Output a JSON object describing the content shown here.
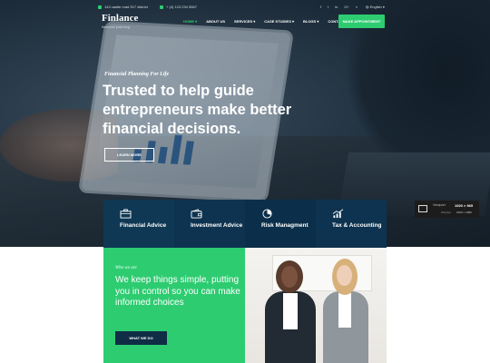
{
  "topbar": {
    "address": "143 castle road 517 district",
    "phone": "+ (4) 123 234 5567",
    "social": [
      "f",
      "t",
      "in",
      "G+",
      "⌕"
    ],
    "language": "English ▾"
  },
  "brand": {
    "name": "Finlance",
    "tagline": "financial planning"
  },
  "nav": {
    "items": [
      {
        "label": "HOME ▾",
        "active": true
      },
      {
        "label": "ABOUT US",
        "active": false
      },
      {
        "label": "SERVICES ▾",
        "active": false
      },
      {
        "label": "CASE STUDIES ▾",
        "active": false
      },
      {
        "label": "BLOGS ▾",
        "active": false
      },
      {
        "label": "CONTACT",
        "active": false
      }
    ],
    "cta": "MAKE APPOINTMENT"
  },
  "hero": {
    "eyebrow": "Financial Planning For Life",
    "headline": "Trusted to help guide entrepreneurs make better financial decisions.",
    "button": "LEARN MORE"
  },
  "viewport_widget": {
    "label": "Viewport:",
    "value": "1920 × 969",
    "sub_label": "Window:",
    "sub_value": "1920 × 1080"
  },
  "services": [
    {
      "label": "Financial Advice",
      "icon": "briefcase-icon"
    },
    {
      "label": "Investment Advice",
      "icon": "wallet-icon"
    },
    {
      "label": "Risk Managment",
      "icon": "pie-chart-icon"
    },
    {
      "label": "Tax & Accounting",
      "icon": "growth-chart-icon"
    }
  ],
  "about": {
    "eyebrow": "Who we are",
    "text": "We keep things simple, putting you in control so you can make informed choices",
    "button": "WHAT WE DO"
  },
  "colors": {
    "accent": "#2ecc71",
    "navy": "#0d3350",
    "dark": "#0f2d44"
  }
}
